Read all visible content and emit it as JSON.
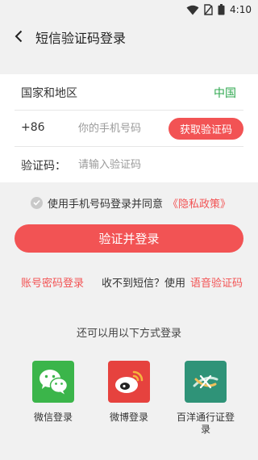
{
  "status_bar": {
    "time": "4:10"
  },
  "header": {
    "title": "短信验证码登录"
  },
  "form": {
    "region_label": "国家和地区",
    "region_value": "中国",
    "country_code": "+86",
    "phone_placeholder": "你的手机号码",
    "get_code_label": "获取验证码",
    "code_label": "验证码：",
    "code_placeholder": "请输入验证码"
  },
  "agreement": {
    "text": "使用手机号码登录并同意",
    "link": "《隐私政策》"
  },
  "submit_label": "验证并登录",
  "alternatives": {
    "password_login": "账号密码登录",
    "no_sms": "收不到短信？使用",
    "voice_code": "语音验证码"
  },
  "other_methods": {
    "title": "还可以用以下方式登录",
    "providers": [
      {
        "name": "微信登录",
        "icon": "wechat-icon"
      },
      {
        "name": "微博登录",
        "icon": "weibo-icon"
      },
      {
        "name": "百洋通行证登录",
        "icon": "baiyang-passport-icon"
      }
    ]
  },
  "colors": {
    "accent": "#f25354",
    "region_green": "#2fa84f",
    "background": "#f1f1f1"
  }
}
